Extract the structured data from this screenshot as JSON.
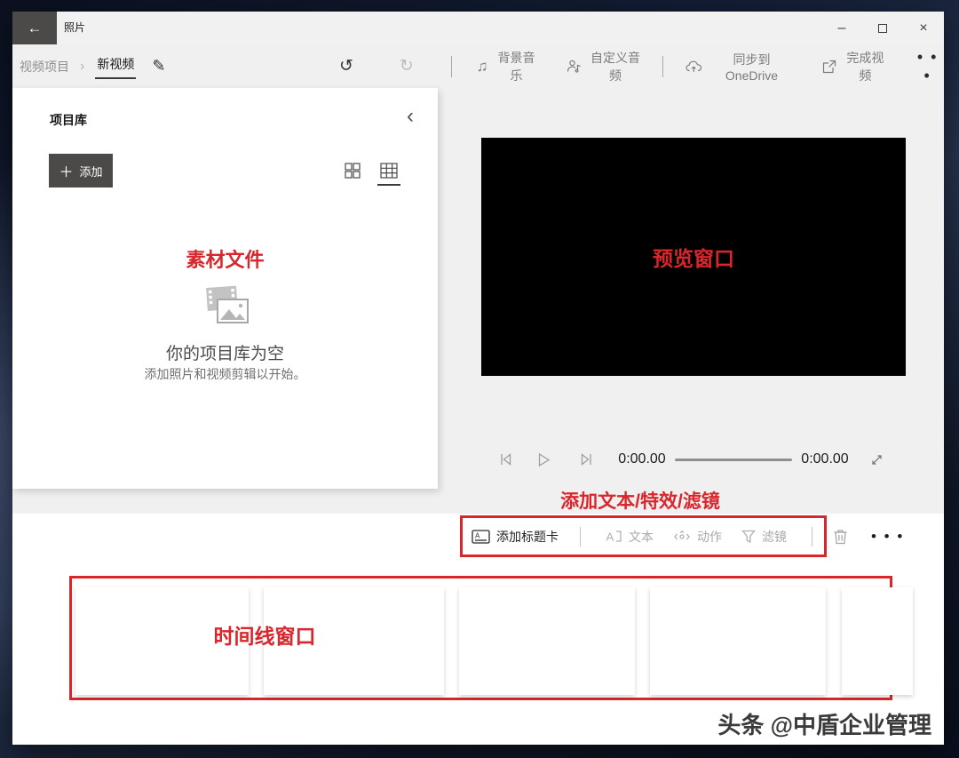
{
  "window": {
    "title": "照片"
  },
  "icons": {
    "back": "←",
    "minimize": "–",
    "close": "×",
    "breadcrumb_separator": "›",
    "edit": "✎",
    "undo": "↺",
    "redo": "↻",
    "music_note": "♫",
    "collapse": "‹",
    "add_plus": "＋",
    "more": "• • •"
  },
  "breadcrumb": {
    "root": "视频项目",
    "current": "新视频"
  },
  "command_bar": {
    "background_music": "背景音乐",
    "custom_audio": "自定义音频",
    "sync_onedrive": "同步到 OneDrive",
    "finish_video": "完成视频"
  },
  "library": {
    "header": "项目库",
    "add_button": "添加",
    "annotation": "素材文件",
    "empty_title": "你的项目库为空",
    "empty_subtitle": "添加照片和视频剪辑以开始。"
  },
  "preview": {
    "annotation": "预览窗口"
  },
  "playback": {
    "current_time": "0:00.00",
    "total_time": "0:00.00"
  },
  "effects_toolbar": {
    "annotation": "添加文本/特效/滤镜",
    "add_title_card": "添加标题卡",
    "text": "文本",
    "motion": "动作",
    "filter": "滤镜"
  },
  "timeline": {
    "annotation": "时间线窗口"
  },
  "watermark": "头条 @中盾企业管理",
  "colors": {
    "annotation_red": "#d8262c",
    "button_dark": "#4c4a48",
    "desktop_navy": "#141e36"
  }
}
